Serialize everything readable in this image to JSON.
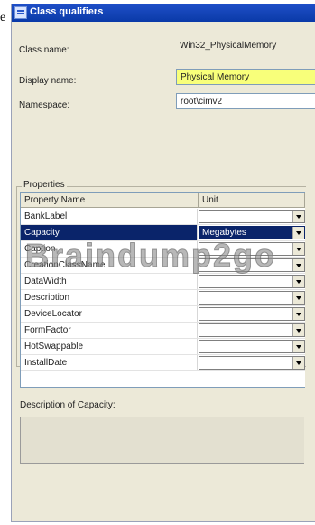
{
  "edge_text": "e",
  "window": {
    "title": "Class qualifiers"
  },
  "form": {
    "class_name_label": "Class name:",
    "class_name_value": "Win32_PhysicalMemory",
    "display_name_label": "Display name:",
    "display_name_value": "Physical Memory",
    "namespace_label": "Namespace:",
    "namespace_value": "root\\cimv2"
  },
  "properties": {
    "group_label": "Properties",
    "columns": [
      "Property Name",
      "Unit"
    ],
    "rows": [
      {
        "name": "BankLabel",
        "unit": ""
      },
      {
        "name": "Capacity",
        "unit": "Megabytes",
        "selected": true
      },
      {
        "name": "Caption",
        "unit": ""
      },
      {
        "name": "CreationClassName",
        "unit": ""
      },
      {
        "name": "DataWidth",
        "unit": ""
      },
      {
        "name": "Description",
        "unit": ""
      },
      {
        "name": "DeviceLocator",
        "unit": ""
      },
      {
        "name": "FormFactor",
        "unit": ""
      },
      {
        "name": "HotSwappable",
        "unit": ""
      },
      {
        "name": "InstallDate",
        "unit": ""
      }
    ]
  },
  "description": {
    "label": "Description of Capacity:",
    "value": ""
  },
  "watermark": "Braindump2go",
  "colors": {
    "title_bar": "#0a3aa8",
    "highlight": "#f8ff7a",
    "selection": "#0a246a"
  }
}
